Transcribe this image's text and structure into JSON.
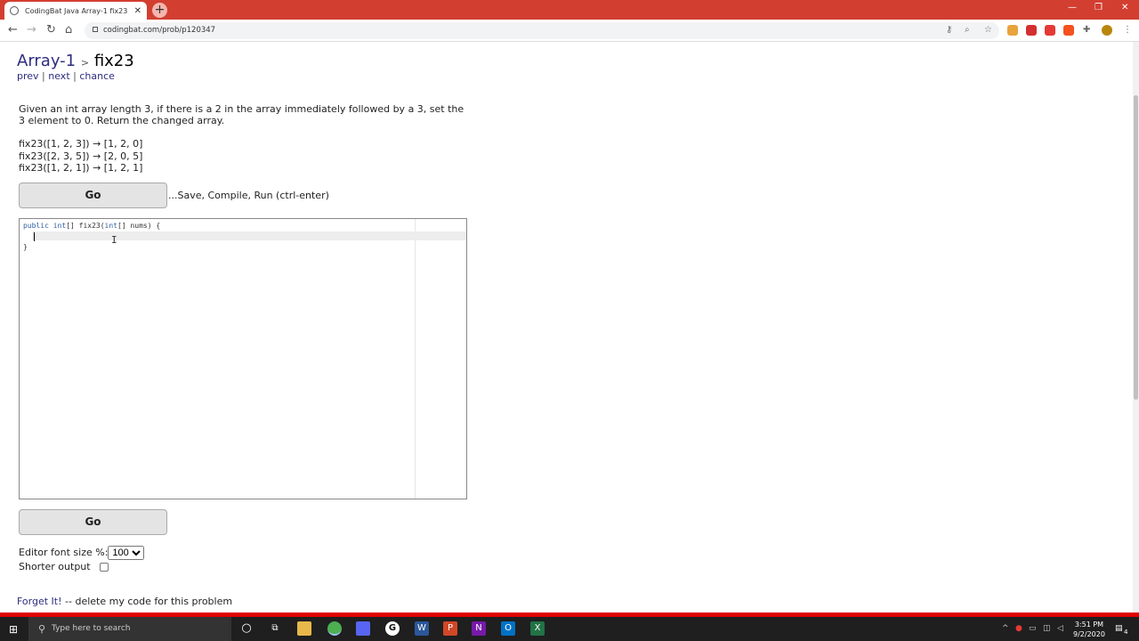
{
  "browser": {
    "tab_title": "CodingBat Java Array-1 fix23",
    "url": "codingbat.com/prob/p120347",
    "new_tab_label": "+",
    "tab_close": "✕"
  },
  "page": {
    "breadcrumb_parent": "Array-1",
    "breadcrumb_sep": ">",
    "problem_name": "fix23",
    "nav": {
      "prev": "prev",
      "next": "next",
      "chance": "chance",
      "sep": "|"
    },
    "description": "Given an int array length 3, if there is a 2 in the array immediately followed by a 3, set the 3 element to 0. Return the changed array.",
    "examples": [
      "fix23([1, 2, 3]) → [1, 2, 0]",
      "fix23([2, 3, 5]) → [2, 0, 5]",
      "fix23([1, 2, 1]) → [1, 2, 1]"
    ],
    "go_label": "Go",
    "go_hint": "...Save, Compile, Run (ctrl-enter)",
    "code": {
      "line1_kw1": "public",
      "line1_kw2": "int",
      "line1_rest1": "[] fix23(",
      "line1_kw3": "int",
      "line1_rest2": "[] nums) {",
      "line3": "}"
    },
    "font_size_label": "Editor font size %:",
    "font_size_value": "100",
    "shorter_label": "Shorter output",
    "forget_link": "Forget It!",
    "forget_text": " -- delete my code for this problem"
  },
  "taskbar": {
    "search_placeholder": "Type here to search",
    "time": "3:51 PM",
    "date": "9/2/2020",
    "notif_count": "4"
  }
}
